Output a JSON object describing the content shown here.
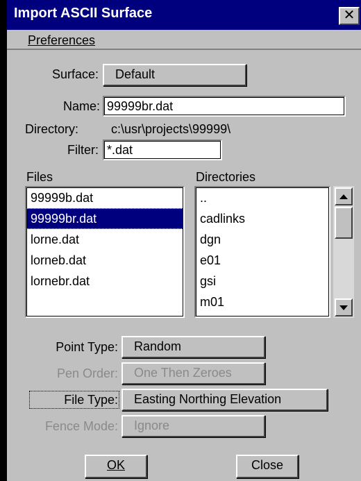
{
  "window": {
    "title": "Import ASCII Surface",
    "close_symbol": "✕"
  },
  "menu": {
    "preferences": "Preferences"
  },
  "surface": {
    "label": "Surface:",
    "value": "Default"
  },
  "name": {
    "label": "Name:",
    "value": "99999br.dat"
  },
  "directory": {
    "label": "Directory:",
    "value": "c:\\usr\\projects\\99999\\"
  },
  "filter": {
    "label": "Filter:",
    "value": "*.dat"
  },
  "files": {
    "header": "Files",
    "items": [
      "99999b.dat",
      "99999br.dat",
      "lorne.dat",
      "lorneb.dat",
      "lornebr.dat"
    ],
    "selected_index": 1
  },
  "directories": {
    "header": "Directories",
    "items": [
      "..",
      "cadlinks",
      "dgn",
      "e01",
      "gsi",
      "m01"
    ]
  },
  "point_type": {
    "label": "Point Type:",
    "value": "Random"
  },
  "pen_order": {
    "label": "Pen Order:",
    "value": "One Then Zeroes"
  },
  "file_type": {
    "label": "File Type:",
    "value": "Easting Northing Elevation"
  },
  "fence_mode": {
    "label": "Fence Mode:",
    "value": "Ignore"
  },
  "buttons": {
    "ok": "OK",
    "close": "Close"
  },
  "colors": {
    "title_bar": "#00007f",
    "dialog_face": "#c0c0c0",
    "selection": "#00007f"
  }
}
